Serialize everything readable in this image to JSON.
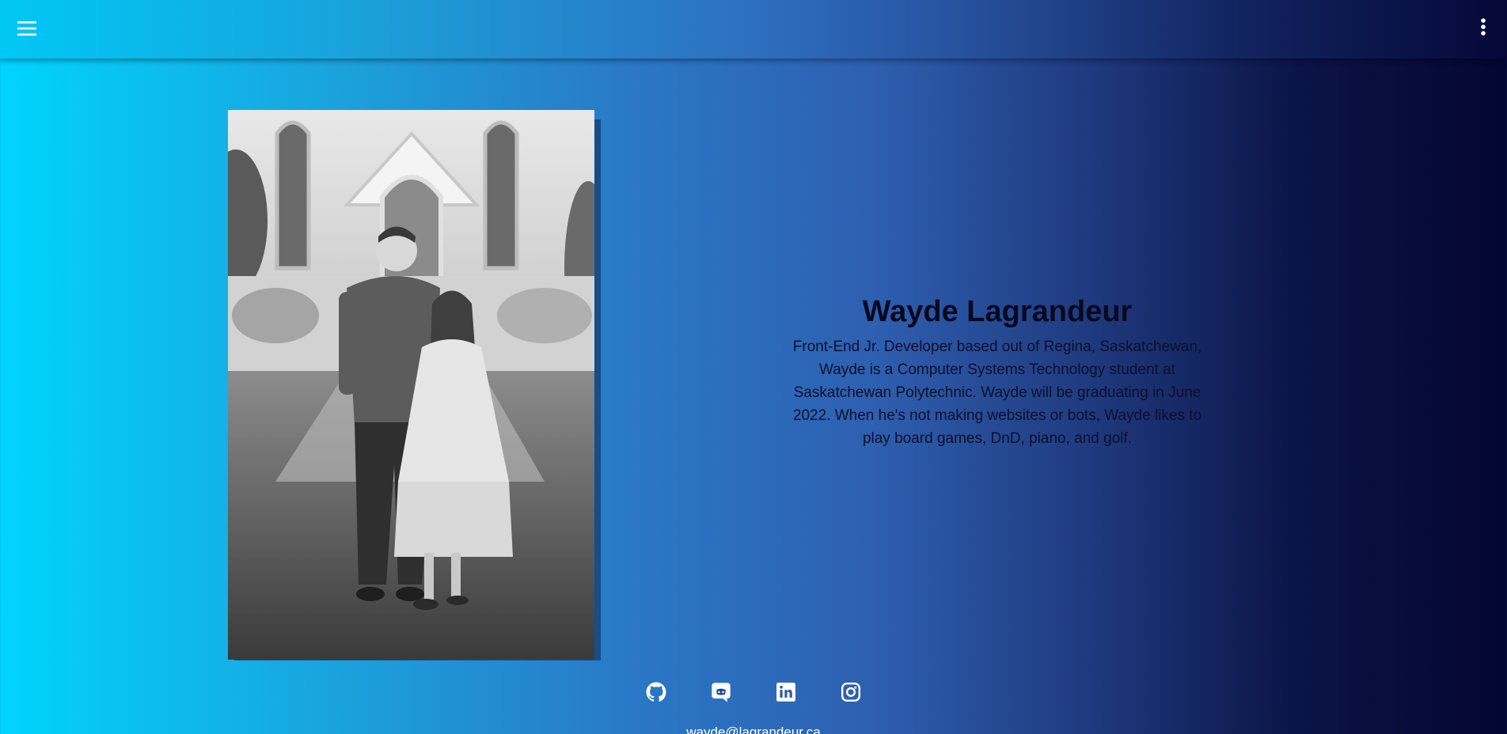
{
  "header": {
    "menu_icon": "hamburger-menu-icon",
    "more_icon": "more-vertical-icon"
  },
  "profile": {
    "name": "Wayde Lagrandeur",
    "bio": "Front-End Jr. Developer based out of Regina, Saskatchewan, Wayde is a Computer Systems Technology student at Saskatchewan Polytechnic. Wayde will be graduating in June 2022. When he's not making websites or bots, Wayde likes to play board games, DnD, piano, and golf.",
    "photo_icon": "portrait-photo"
  },
  "socials": [
    {
      "icon": "github-icon"
    },
    {
      "icon": "discord-icon"
    },
    {
      "icon": "linkedin-icon"
    },
    {
      "icon": "instagram-icon"
    }
  ],
  "footer": {
    "email": "wayde@lagrandeur.ca"
  },
  "colors": {
    "gradient_start": "#00d4ff",
    "gradient_end": "#040631",
    "photo_shadow": "#174e86",
    "text_dark": "#08091f"
  }
}
